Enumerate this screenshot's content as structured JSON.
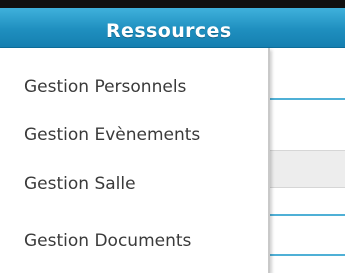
{
  "menu": {
    "title": "Ressources",
    "items": [
      {
        "label": "Gestion Personnels"
      },
      {
        "label": "Gestion Evènements"
      },
      {
        "label": "Gestion Salle"
      },
      {
        "label": "Gestion Documents"
      }
    ]
  },
  "colors": {
    "header": "#1f8fbf",
    "accent_line": "#4fb0d6",
    "item_text": "#3a3a3a"
  }
}
